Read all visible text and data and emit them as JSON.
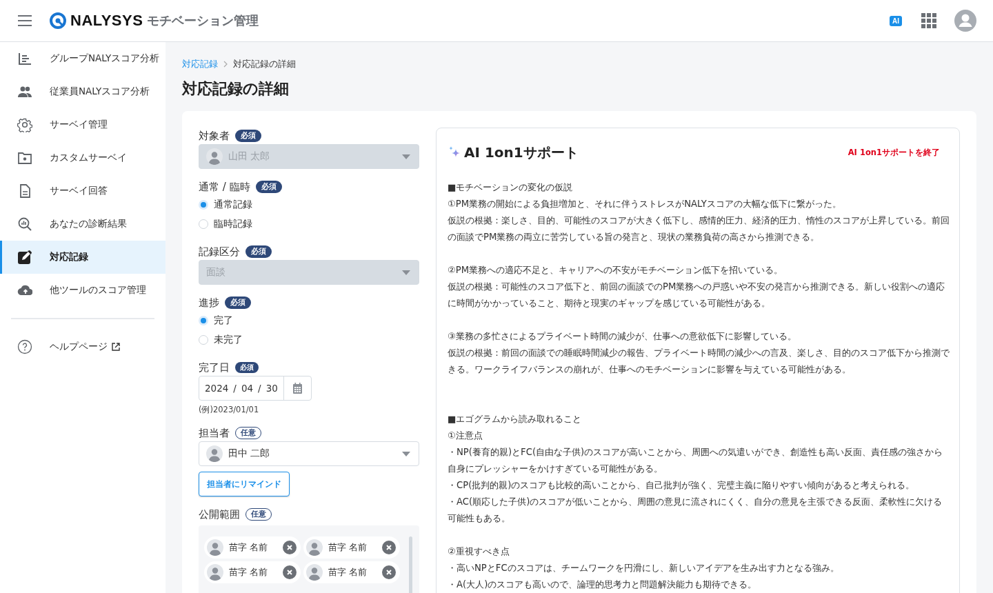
{
  "header": {
    "brand": "NALYSYS",
    "product": "モチベーション管理",
    "ai_badge": "AI"
  },
  "sidebar": {
    "items": [
      {
        "label": "グループNALYスコア分析",
        "selected": false
      },
      {
        "label": "従業員NALYスコア分析",
        "selected": false
      },
      {
        "label": "サーベイ管理",
        "selected": false
      },
      {
        "label": "カスタムサーベイ",
        "selected": false
      },
      {
        "label": "サーベイ回答",
        "selected": false
      },
      {
        "label": "あなたの診断結果",
        "selected": false
      },
      {
        "label": "対応記録",
        "selected": true
      },
      {
        "label": "他ツールのスコア管理",
        "selected": false
      }
    ],
    "help": {
      "label": "ヘルプページ"
    }
  },
  "breadcrumb": [
    {
      "label": "対応記録",
      "kind": "link"
    },
    {
      "label": "対応記録の詳細",
      "kind": "current"
    }
  ],
  "page_title": "対応記録の詳細",
  "form": {
    "fields": [
      {
        "kind": "select",
        "label": "対象者",
        "badge": {
          "text": "必須",
          "kind": "required"
        },
        "value": "山田 太郎",
        "avatar": true,
        "disabled": true
      },
      {
        "kind": "radio",
        "label": "通常 / 臨時",
        "badge": {
          "text": "必須",
          "kind": "required"
        },
        "options": [
          {
            "label": "通常記録",
            "selected": true
          },
          {
            "label": "臨時記録",
            "selected": false
          }
        ]
      },
      {
        "kind": "select",
        "label": "記録区分",
        "badge": {
          "text": "必須",
          "kind": "required"
        },
        "value": "面談",
        "avatar": false,
        "disabled": true
      },
      {
        "kind": "radio",
        "label": "進捗",
        "badge": {
          "text": "必須",
          "kind": "required"
        },
        "options": [
          {
            "label": "完了",
            "selected": true
          },
          {
            "label": "未完了",
            "selected": false
          }
        ]
      },
      {
        "kind": "date",
        "label": "完了日",
        "badge": {
          "text": "必須",
          "kind": "required-small"
        },
        "parts": [
          "2024",
          "/",
          "04",
          "/",
          "30"
        ],
        "hint": "(例)2023/01/01"
      },
      {
        "kind": "select",
        "label": "担当者",
        "badge": {
          "text": "任意",
          "kind": "optional"
        },
        "value": "田中 二郎",
        "avatar": true,
        "disabled": false,
        "button": "担当者にリマインド"
      },
      {
        "kind": "chips",
        "label": "公開範囲",
        "badge": {
          "text": "任意",
          "kind": "optional"
        },
        "chips": [
          "苗字 名前",
          "苗字 名前",
          "苗字 名前",
          "苗字 名前"
        ]
      }
    ]
  },
  "ai_panel": {
    "title": "AI 1on1サポート",
    "end_link": "AI 1on1サポートを終了",
    "blocks": [
      {
        "kind": "section",
        "lines": [
          "■モチベーションの変化の仮説",
          "①PM業務の開始による負担増加と、それに伴うストレスがNALYスコアの大幅な低下に繋がった。",
          "仮説の根拠：楽しさ、目的、可能性のスコアが大きく低下し、感情的圧力、経済的圧力、惰性のスコアが上昇している。前回の面談でPM業務の両立に苦労している旨の発言と、現状の業務負荷の高さから推測できる。"
        ]
      },
      {
        "kind": "item",
        "lines": [
          "②PM業務への適応不足と、キャリアへの不安がモチベーション低下を招いている。",
          "仮説の根拠：可能性のスコア低下と、前回の面談でのPM業務への戸惑いや不安の発言から推測できる。新しい役割への適応に時間がかかっていること、期待と現実のギャップを感じている可能性がある。"
        ]
      },
      {
        "kind": "item",
        "lines": [
          "③業務の多忙さによるプライベート時間の減少が、仕事への意欲低下に影響している。",
          "仮説の根拠：前回の面談での睡眠時間減少の報告、プライベート時間の減少への言及、楽しさ、目的のスコア低下から推測できる。ワークライフバランスの崩れが、仕事へのモチベーションに影響を与えている可能性がある。"
        ]
      },
      {
        "kind": "section",
        "lines": [
          "■エゴグラムから読み取れること",
          "①注意点",
          "・NP(養育的親)とFC(自由な子供)のスコアが高いことから、周囲への気遣いができ、創造性も高い反面、責任感の強さから自身にプレッシャーをかけすぎている可能性がある。",
          "・CP(批判的親)のスコアも比較的高いことから、自己批判が強く、完璧主義に陥りやすい傾向があると考えられる。",
          "・AC(順応した子供)のスコアが低いことから、周囲の意見に流されにくく、自分の意見を主張できる反面、柔軟性に欠ける可能性もある。"
        ]
      },
      {
        "kind": "item",
        "lines": [
          "②重視すべき点",
          "・高いNPとFCのスコアは、チームワークを円滑にし、新しいアイデアを生み出す力となる強み。",
          "・A(大人)のスコアも高いので、論理的思考力と問題解決能力も期待できる。"
        ]
      }
    ]
  }
}
